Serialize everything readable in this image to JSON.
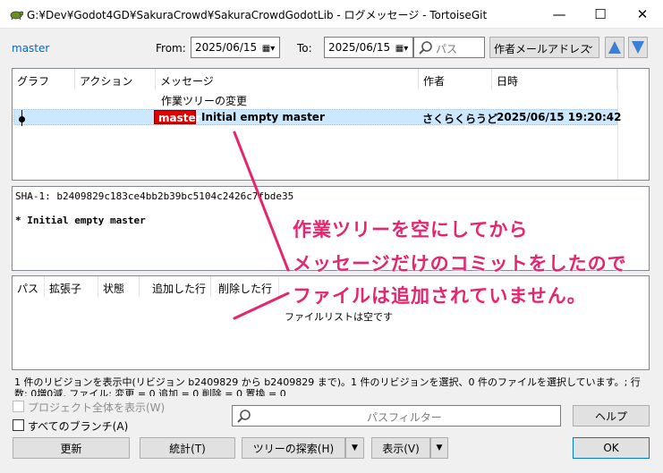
{
  "window": {
    "title": "G:¥Dev¥Godot4GD¥SakuraCrowd¥SakuraCrowdGodotLib - ログメッセージ - TortoiseGit",
    "min_glyph": "—",
    "max_glyph": "☐",
    "close_glyph": "✕"
  },
  "toolbar": {
    "branch": "master",
    "from_label": "From:",
    "from_date": "2025/06/15",
    "to_label": "To:",
    "to_date": "2025/06/15",
    "search_placeholder": "パス",
    "search_filter_field": "作者メールアドレス"
  },
  "log": {
    "columns": [
      "グラフ",
      "アクション",
      "メッセージ",
      "作者",
      "日時"
    ],
    "working_tree_row": "作業ツリーの変更",
    "commits": [
      {
        "branch_tag": "master",
        "message": "Initial empty master",
        "author": "さくらくらうど",
        "date": "2025/06/15 19:20:42"
      }
    ]
  },
  "commit_detail": {
    "sha_line": "SHA-1: b2409829c183ce4bb2b39bc5104c2426c7fbde35",
    "message_line": "* Initial empty master"
  },
  "files": {
    "columns": [
      "パス",
      "拡張子",
      "状態",
      "追加した行",
      "削除した行"
    ],
    "empty_text": "ファイルリストは空です"
  },
  "status_text": "1 件のリビジョンを表示中(リビジョン b2409829 から b2409829 まで)。1 件のリビジョンを選択、0 件のファイルを選択しています。; 行数: 0増0減, ファイル: 変更 = 0 追加 = 0 削除 = 0 置換 = 0",
  "options": {
    "show_whole_project": "プロジェクト全体を表示(W)",
    "all_branches": "すべてのブランチ(A)",
    "path_filter_placeholder": "パスフィルター",
    "help_button": "ヘルプ"
  },
  "buttons": {
    "refresh": "更新",
    "stats": "統計(T)",
    "browse_tree": "ツリーの探索(H)",
    "view": "表示(V)",
    "ok": "OK",
    "split_arrow": "▼"
  },
  "annotation": {
    "lines": [
      "作業ツリーを空にしてから",
      "メッセージだけのコミットをしたので",
      "ファイルは追加されていません。"
    ],
    "color": "#e6256f"
  }
}
